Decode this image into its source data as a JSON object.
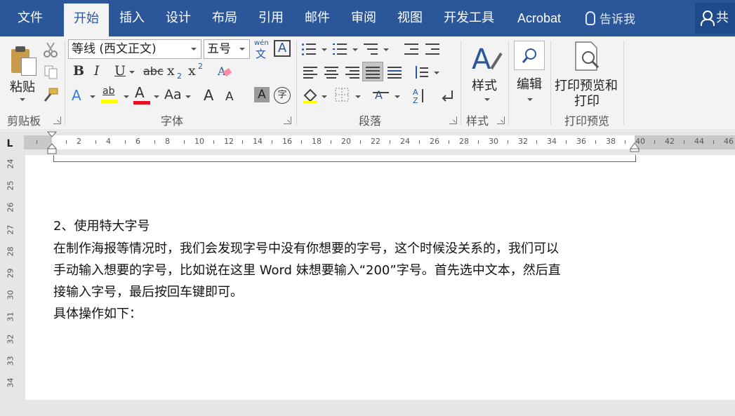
{
  "menubar": {
    "tabs": [
      {
        "label": "文件",
        "active": false
      },
      {
        "label": "开始",
        "active": true
      },
      {
        "label": "插入",
        "active": false
      },
      {
        "label": "设计",
        "active": false
      },
      {
        "label": "布局",
        "active": false
      },
      {
        "label": "引用",
        "active": false
      },
      {
        "label": "邮件",
        "active": false
      },
      {
        "label": "审阅",
        "active": false
      },
      {
        "label": "视图",
        "active": false
      },
      {
        "label": "开发工具",
        "active": false
      },
      {
        "label": "Acrobat",
        "active": false
      }
    ],
    "tell_me": "告诉我",
    "share": "共"
  },
  "ribbon": {
    "clipboard": {
      "paste_label": "粘贴",
      "group_label": "剪贴板"
    },
    "font": {
      "font_name": "等线 (西文正文)",
      "font_size": "五号",
      "phonetic_top": "wén",
      "phonetic_bottom": "文",
      "char_border": "A",
      "bold": "B",
      "italic": "I",
      "underline": "U",
      "strike": "abc",
      "subscript": "x",
      "sub_mark": "2",
      "superscript": "x",
      "sup_mark": "2",
      "text_effect": "A",
      "highlight": "ab",
      "font_color": "A",
      "change_case": "Aa",
      "grow_font": "A",
      "shrink_font": "A",
      "char_shading": "A",
      "enclose": "字",
      "group_label": "字体"
    },
    "paragraph": {
      "group_label": "段落"
    },
    "styles": {
      "label": "样式",
      "group_label": "样式"
    },
    "editing": {
      "label": "编辑"
    },
    "print_preview": {
      "label_line1": "打印预览和",
      "label_line2": "打印",
      "group_label": "打印预览"
    }
  },
  "ruler": {
    "corner": "L",
    "numbers": [
      "2",
      "4",
      "6",
      "8",
      "10",
      "12",
      "14",
      "16",
      "18",
      "20",
      "22",
      "24",
      "26",
      "28",
      "30",
      "32",
      "34",
      "36",
      "38",
      "40",
      "42",
      "44",
      "46"
    ]
  },
  "vruler": {
    "numbers": [
      "24",
      "25",
      "26",
      "27",
      "28",
      "29",
      "30",
      "31",
      "32",
      "33",
      "34"
    ]
  },
  "document": {
    "paragraphs": [
      "2、使用特大字号",
      "在制作海报等情况时，我们会发现字号中没有你想要的字号，这个时候没关系的，我们可以",
      "手动输入想要的字号，比如说在这里 Word 妹想要输入“200”字号。首先选中文本，然后直",
      "接输入字号，最后按回车键即可。",
      "具体操作如下："
    ]
  },
  "colors": {
    "accent": "#2b579a",
    "highlight_yellow": "#ffff00",
    "font_red": "#e81123"
  }
}
